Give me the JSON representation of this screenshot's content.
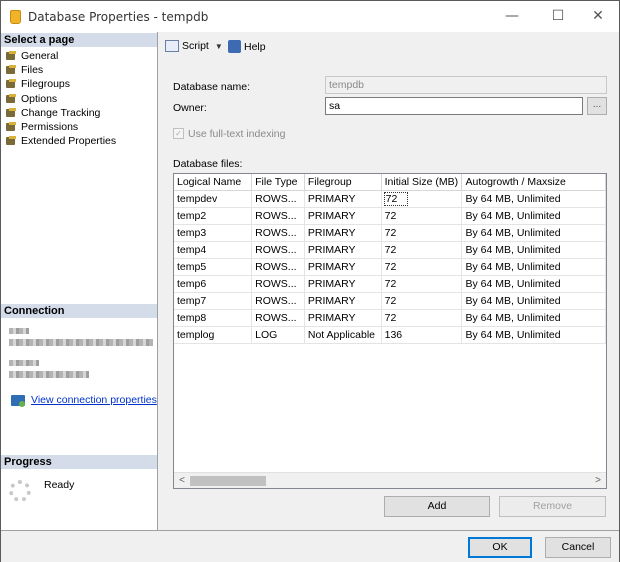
{
  "window": {
    "title": "Database Properties - tempdb",
    "minimize": "—",
    "maximize": "☐",
    "close": "✕"
  },
  "left": {
    "select_page_header": "Select a page",
    "pages": [
      "General",
      "Files",
      "Filegroups",
      "Options",
      "Change Tracking",
      "Permissions",
      "Extended Properties"
    ],
    "connection_header": "Connection",
    "view_connection_properties": "View connection properties",
    "progress_header": "Progress",
    "progress_status": "Ready"
  },
  "toolbar": {
    "script_label": "Script",
    "help_label": "Help"
  },
  "form": {
    "database_name_label": "Database name:",
    "database_name_value": "tempdb",
    "owner_label": "Owner:",
    "owner_value": "sa",
    "owner_browse": "...",
    "fulltext_label": "Use full-text indexing",
    "database_files_label": "Database files:"
  },
  "files_table": {
    "columns": [
      "Logical Name",
      "File Type",
      "Filegroup",
      "Initial Size (MB)",
      "Autogrowth / Maxsize"
    ],
    "rows": [
      [
        "tempdev",
        "ROWS...",
        "PRIMARY",
        "72",
        "By 64 MB, Unlimited"
      ],
      [
        "temp2",
        "ROWS...",
        "PRIMARY",
        "72",
        "By 64 MB, Unlimited"
      ],
      [
        "temp3",
        "ROWS...",
        "PRIMARY",
        "72",
        "By 64 MB, Unlimited"
      ],
      [
        "temp4",
        "ROWS...",
        "PRIMARY",
        "72",
        "By 64 MB, Unlimited"
      ],
      [
        "temp5",
        "ROWS...",
        "PRIMARY",
        "72",
        "By 64 MB, Unlimited"
      ],
      [
        "temp6",
        "ROWS...",
        "PRIMARY",
        "72",
        "By 64 MB, Unlimited"
      ],
      [
        "temp7",
        "ROWS...",
        "PRIMARY",
        "72",
        "By 64 MB, Unlimited"
      ],
      [
        "temp8",
        "ROWS...",
        "PRIMARY",
        "72",
        "By 64 MB, Unlimited"
      ],
      [
        "templog",
        "LOG",
        "Not Applicable",
        "136",
        "By 64 MB, Unlimited"
      ]
    ]
  },
  "buttons": {
    "add": "Add",
    "remove": "Remove",
    "ok": "OK",
    "cancel": "Cancel"
  },
  "colors": {
    "section_header_bg": "#d4dbe9",
    "link": "#0033cc",
    "default_button_border": "#0078d7"
  }
}
